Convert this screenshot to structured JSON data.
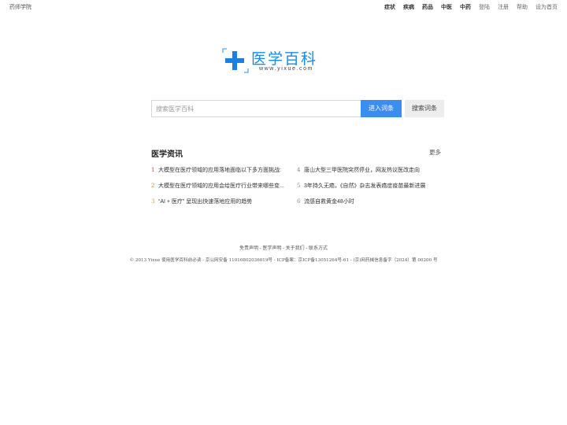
{
  "topbar": {
    "site_name": "药师学院",
    "nav": [
      "症状",
      "疾病",
      "药品",
      "中医",
      "中药",
      "登陆",
      "注册",
      "帮助",
      "设为首页"
    ],
    "bold_items": [
      "症状",
      "疾病",
      "药品",
      "中医",
      "中药"
    ]
  },
  "logo": {
    "chinese": "医学百科",
    "url": "www.yixue.com",
    "brand_color": "#1a8ae6"
  },
  "search": {
    "placeholder": "搜索医学百科",
    "value": "",
    "enter_label": "进入词条",
    "search_label": "搜索词条",
    "enter_color": "#3c8df0"
  },
  "news": {
    "title": "医学资讯",
    "more": "更多",
    "items": [
      {
        "num": "1",
        "text": "大模型在医疗领域的应用落地面临以下多方面挑战:"
      },
      {
        "num": "2",
        "text": "大模型在医疗领域的应用会给医疗行业带来哪些变..."
      },
      {
        "num": "3",
        "text": "“AI + 医疗” 呈现出快速落地应用的趋势"
      },
      {
        "num": "4",
        "text": "唐山大型三甲医院突然停业，网友热议医改走向"
      },
      {
        "num": "5",
        "text": "3年持久无癌，《自然》杂志发表癌症疫苗最新进展"
      },
      {
        "num": "6",
        "text": "流感自救黄金48小时"
      }
    ]
  },
  "footer": {
    "links": [
      "免责声明",
      "医学声明",
      "关于我们",
      "联系方式"
    ],
    "separator": " - ",
    "copyright": "© 2013 Yixue 使用医学百科前必读 - 京公网安备 11010802036019号 - ICP备案：京ICP备13051264号-61 - (京)网药械信息备字（2024）第 00200 号"
  }
}
